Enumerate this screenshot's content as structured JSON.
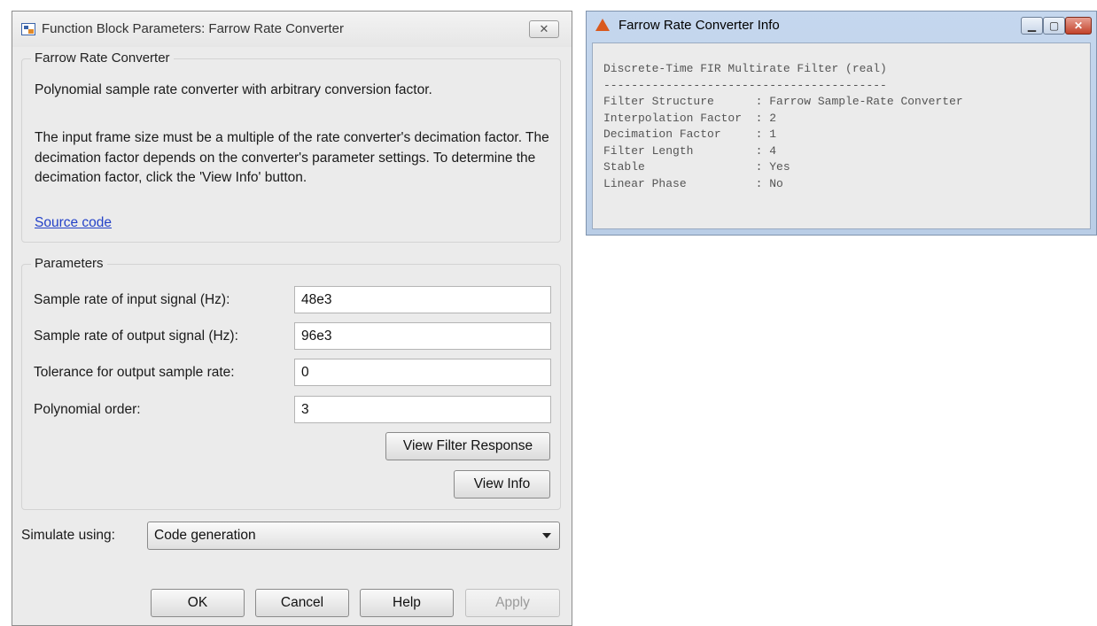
{
  "dialog": {
    "title": "Function Block Parameters: Farrow Rate Converter",
    "close_glyph": "✕",
    "block_group": {
      "legend": "Farrow Rate Converter",
      "description_1": "Polynomial sample rate converter with arbitrary conversion factor.",
      "description_2": "The input frame size must be a multiple of the rate converter's decimation factor. The decimation factor depends on the converter's parameter settings. To determine the decimation factor, click the 'View Info' button.",
      "source_link": "Source code"
    },
    "parameters": {
      "legend": "Parameters",
      "fields": [
        {
          "label": "Sample rate of input signal (Hz):",
          "value": "48e3"
        },
        {
          "label": "Sample rate of output signal (Hz):",
          "value": "96e3"
        },
        {
          "label": "Tolerance for output sample rate:",
          "value": "0"
        },
        {
          "label": "Polynomial order:",
          "value": "3"
        }
      ],
      "view_filter_response": "View Filter Response",
      "view_info": "View Info"
    },
    "simulate": {
      "label": "Simulate using:",
      "selected": "Code generation"
    },
    "buttons": {
      "ok": "OK",
      "cancel": "Cancel",
      "help": "Help",
      "apply": "Apply"
    }
  },
  "info_window": {
    "title": "Farrow Rate Converter Info",
    "minimize_glyph": "▁",
    "maximize_glyph": "▢",
    "close_glyph": "✕",
    "content": "Discrete-Time FIR Multirate Filter (real)\n-----------------------------------------\nFilter Structure      : Farrow Sample-Rate Converter\nInterpolation Factor  : 2\nDecimation Factor     : 1\nFilter Length         : 4\nStable                : Yes\nLinear Phase          : No"
  }
}
